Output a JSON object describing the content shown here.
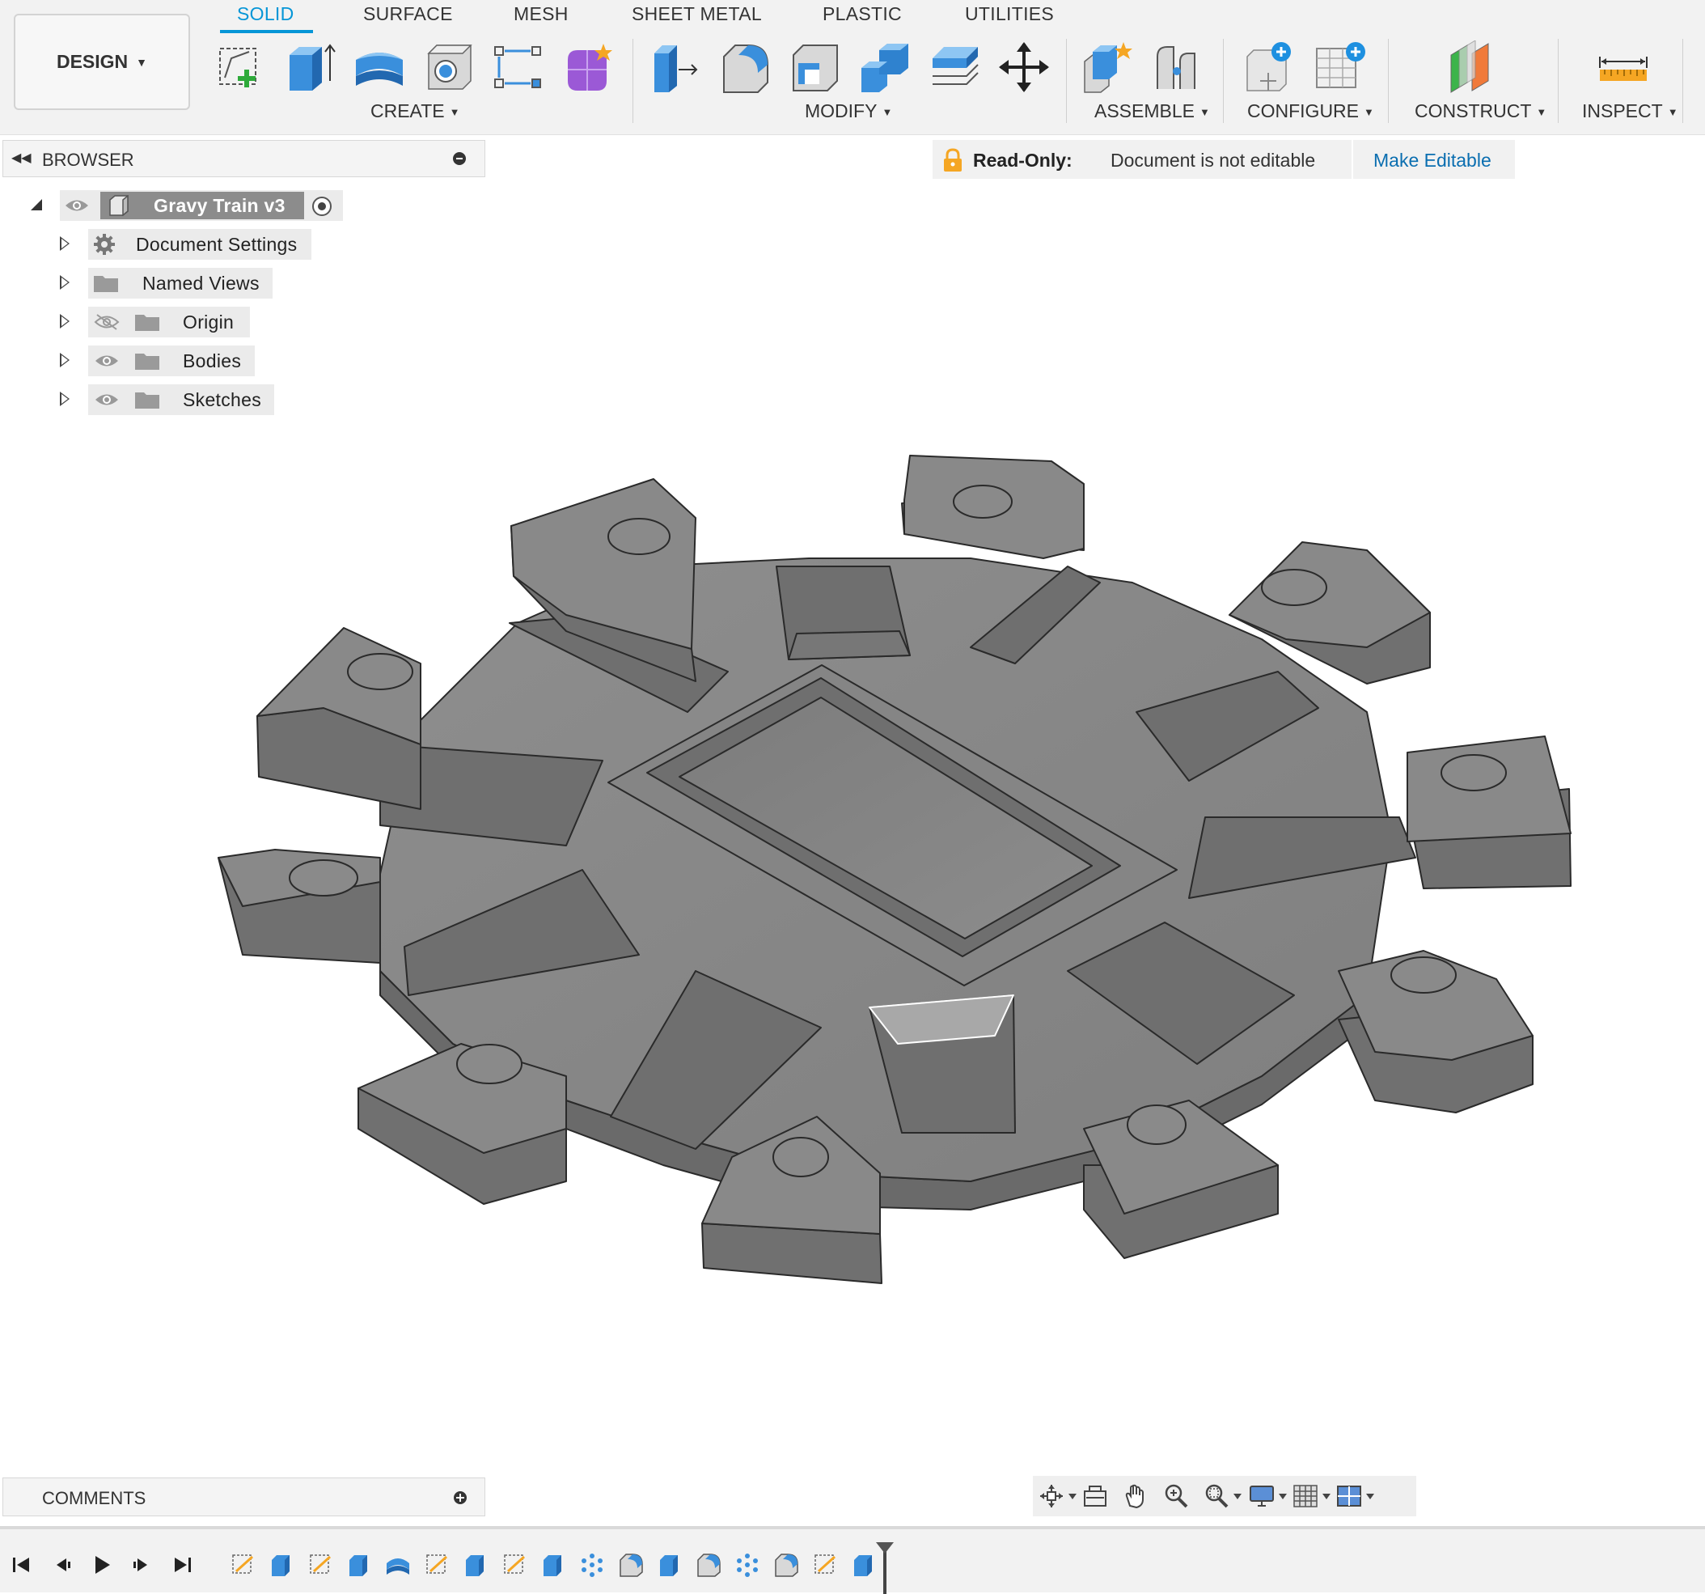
{
  "toolbar": {
    "workspace_label": "DESIGN",
    "tabs": [
      {
        "label": "SOLID",
        "active": true
      },
      {
        "label": "SURFACE"
      },
      {
        "label": "MESH"
      },
      {
        "label": "SHEET METAL"
      },
      {
        "label": "PLASTIC"
      },
      {
        "label": "UTILITIES"
      }
    ],
    "groups": {
      "create": "CREATE",
      "modify": "MODIFY",
      "assemble": "ASSEMBLE",
      "configure": "CONFIGURE",
      "construct": "CONSTRUCT",
      "inspect": "INSPECT"
    },
    "accent_color": "#0696d7"
  },
  "browser": {
    "title": "BROWSER",
    "root": "Gravy Train v3",
    "items": [
      {
        "label": "Document Settings",
        "icon": "gear-icon"
      },
      {
        "label": "Named Views",
        "icon": "folder-icon"
      },
      {
        "label": "Origin",
        "icon": "folder-icon",
        "visibility": "hidden"
      },
      {
        "label": "Bodies",
        "icon": "folder-icon",
        "visibility": "visible"
      },
      {
        "label": "Sketches",
        "icon": "folder-icon",
        "visibility": "visible"
      }
    ]
  },
  "banner": {
    "label": "Read-Only:",
    "message": "Document is not editable",
    "action": "Make Editable"
  },
  "comments": {
    "title": "COMMENTS"
  },
  "nav_icons": [
    "orbit-icon",
    "look-at-icon",
    "pan-icon",
    "zoom-icon",
    "fit-icon",
    "display-settings-icon",
    "grid-icon",
    "viewports-icon"
  ],
  "timeline": {
    "controls": [
      "go-to-start-icon",
      "step-back-icon",
      "play-icon",
      "step-forward-icon",
      "go-to-end-icon"
    ],
    "steps": [
      "sketch-icon",
      "extrude-icon",
      "sketch-icon",
      "extrude-icon",
      "revolve-icon",
      "sketch-icon",
      "extrude-icon",
      "sketch-icon",
      "extrude-icon",
      "pattern-icon",
      "fillet-icon",
      "extrude-icon",
      "fillet-icon",
      "pattern-icon",
      "fillet-icon",
      "sketch-icon",
      "extrude-icon"
    ]
  }
}
